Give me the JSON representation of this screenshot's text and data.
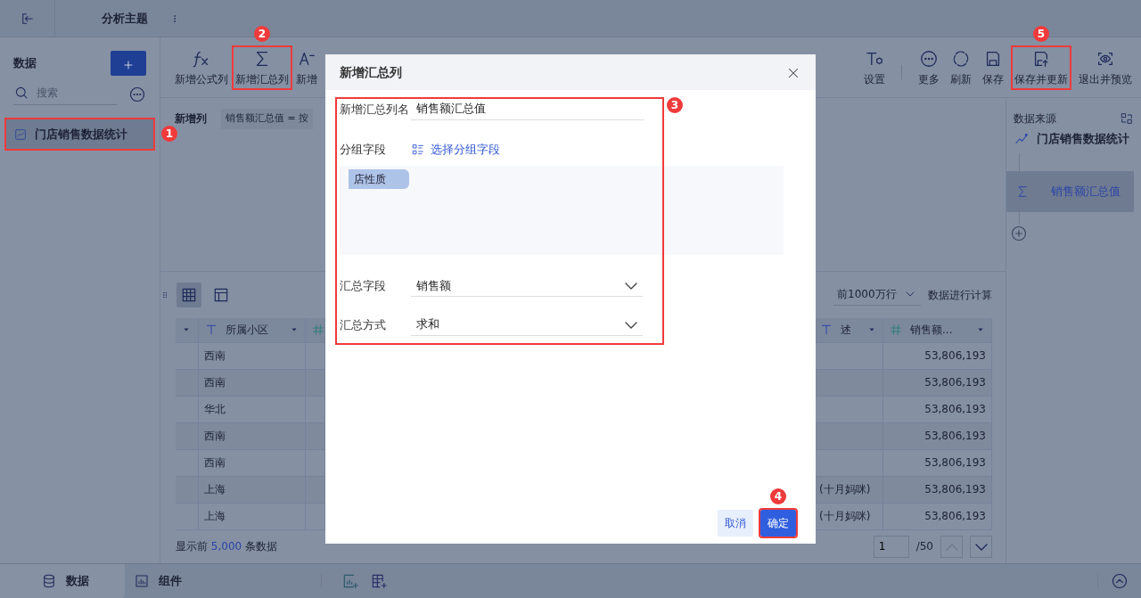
{
  "app": {
    "title": "分析主题"
  },
  "sidebar": {
    "title": "数据",
    "search": {
      "placeholder": "搜索"
    },
    "items": [
      {
        "label": "门店销售数据统计",
        "selected": true,
        "annotation": "1"
      }
    ]
  },
  "toolbar_left": [
    {
      "label": "新增公式列"
    },
    {
      "label": "新增汇总列",
      "annotation": "2"
    },
    {
      "label": "新增"
    }
  ],
  "toolbar_right": [
    {
      "label": "设置"
    },
    {
      "label": "更多"
    },
    {
      "label": "刷新"
    },
    {
      "label": "保存"
    },
    {
      "label": "保存并更新",
      "annotation": "5"
    },
    {
      "label": "退出并预览"
    }
  ],
  "new_columns": {
    "label": "新增列",
    "chips": [
      "销售额汇总值 = 按"
    ]
  },
  "table_toolbar": {
    "views": [
      {
        "kind": "grid",
        "selected": true
      },
      {
        "kind": "layout",
        "selected": false
      }
    ],
    "row_limit": "前1000万行",
    "note": "数据进行计算"
  },
  "table": {
    "columns": [
      {
        "label": "所属小区",
        "kind": "text"
      },
      {
        "kind": "number"
      },
      {
        "label": "述",
        "kind": "text"
      },
      {
        "label": "销售额...",
        "kind": "number"
      }
    ],
    "rows": [
      {
        "district": "西南",
        "sales": "53,806,193"
      },
      {
        "district": "西南",
        "sales": "53,806,193"
      },
      {
        "district": "华北",
        "sales": "53,806,193"
      },
      {
        "district": "西南",
        "sales": "53,806,193"
      },
      {
        "district": "西南",
        "sales": "53,806,193"
      },
      {
        "district": "上海",
        "column_3": "(十月妈咪)",
        "sales": "53,806,193"
      },
      {
        "district": "上海",
        "column_3": "(十月妈咪)",
        "sales": "53,806,193"
      }
    ]
  },
  "footer": {
    "prefix": "显示前",
    "count": "5,000",
    "suffix": "条数据"
  },
  "pagination": {
    "page": "1",
    "total": "/50"
  },
  "source_panel": {
    "title": "数据来源",
    "source": "门店销售数据统计",
    "steps": [
      {
        "label": "销售额汇总值",
        "selected": true
      }
    ]
  },
  "bottom_tabs": [
    {
      "label": "数据",
      "selected": true
    },
    {
      "label": "组件",
      "selected": false
    }
  ],
  "dialog": {
    "title": "新增汇总列",
    "form_annotation": "3",
    "name_label": "新增汇总列名",
    "name_value": "销售额汇总值",
    "group_label": "分组字段",
    "group_action": "选择分组字段",
    "group_tags": [
      "店性质"
    ],
    "sum_field_label": "汇总字段",
    "sum_field_value": "销售额",
    "method_label": "汇总方式",
    "method_value": "求和",
    "buttons": [
      {
        "label": "取消",
        "kind": "secondary"
      },
      {
        "label": "确定",
        "kind": "primary",
        "annotation": "4"
      }
    ]
  }
}
